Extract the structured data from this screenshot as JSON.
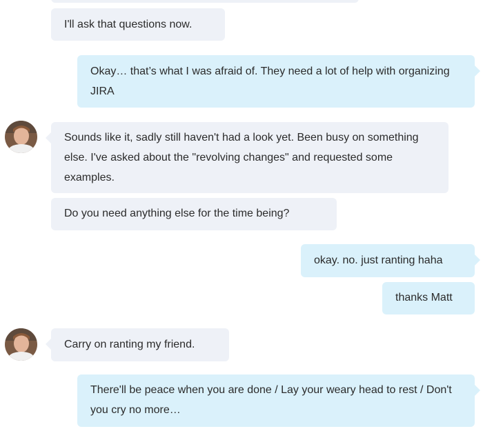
{
  "messages": [
    {
      "id": "m1",
      "direction": "incoming",
      "text": "I'll ask that questions now."
    },
    {
      "id": "m2",
      "direction": "outgoing",
      "text": "Okay… that’s what I was afraid of. They need a lot of help with organizing JIRA"
    },
    {
      "id": "m3",
      "direction": "incoming",
      "text": "Sounds like it, sadly still haven't had a look yet.  Been busy on something else.  I've asked about the \"revolving changes\" and requested some examples."
    },
    {
      "id": "m4",
      "direction": "incoming",
      "text": "Do you need anything else for the time being?"
    },
    {
      "id": "m5",
      "direction": "outgoing",
      "text": "okay. no. just ranting haha"
    },
    {
      "id": "m6",
      "direction": "outgoing",
      "text": "thanks Matt"
    },
    {
      "id": "m7",
      "direction": "incoming",
      "text": "Carry on ranting my friend."
    },
    {
      "id": "m8",
      "direction": "outgoing",
      "text": "There'll be peace when you are done / Lay your weary head to rest / Don't you cry no more…"
    }
  ],
  "colors": {
    "incoming_bubble": "#eef1f7",
    "outgoing_bubble": "#daf1fb",
    "text": "#2b2b2b",
    "background": "#ffffff"
  },
  "icons": {
    "avatar": "contact-avatar-photo"
  }
}
